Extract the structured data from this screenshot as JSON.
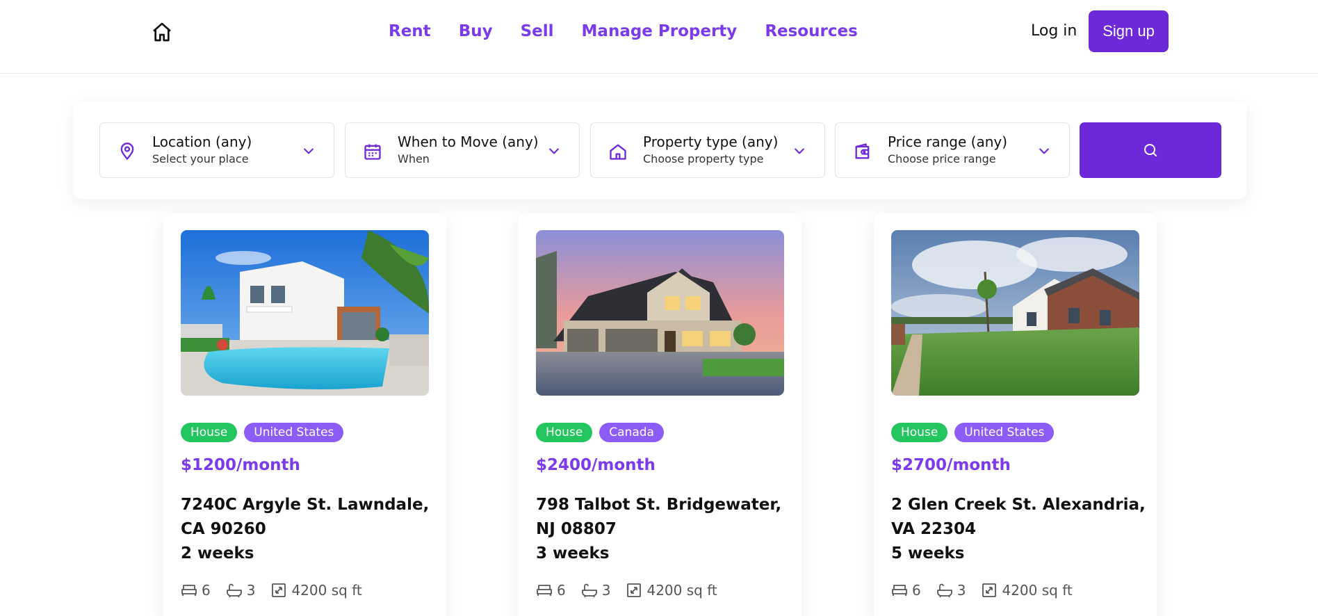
{
  "header": {
    "logo_icon": "home-icon",
    "nav": [
      {
        "label": "Rent"
      },
      {
        "label": "Buy"
      },
      {
        "label": "Sell"
      },
      {
        "label": "Manage Property"
      },
      {
        "label": "Resources"
      }
    ],
    "login_label": "Log in",
    "signup_label": "Sign up"
  },
  "colors": {
    "accent": "#6d28d9",
    "accent_text": "#7c3aed",
    "tag_green": "#22c55e",
    "tag_purple": "#8b5cf6"
  },
  "search": {
    "filters": [
      {
        "icon": "map-pin-icon",
        "title": "Location (any)",
        "subtitle": "Select your place"
      },
      {
        "icon": "calendar-icon",
        "title": "When to Move (any)",
        "subtitle": "When"
      },
      {
        "icon": "house-icon",
        "title": "Property type (any)",
        "subtitle": "Choose property type"
      },
      {
        "icon": "wallet-icon",
        "title": "Price range (any)",
        "subtitle": "Choose price range"
      }
    ],
    "button_icon": "search-icon"
  },
  "listings": [
    {
      "type": "House",
      "country": "United States",
      "price": "$1200/month",
      "address_line1": "7240C Argyle St. Lawndale,",
      "address_line2": "CA 90260",
      "duration": "2 weeks",
      "beds": "6",
      "baths": "3",
      "area": "4200 sq ft"
    },
    {
      "type": "House",
      "country": "Canada",
      "price": "$2400/month",
      "address_line1": "798 Talbot St. Bridgewater,",
      "address_line2": "NJ 08807",
      "duration": "3 weeks",
      "beds": "6",
      "baths": "3",
      "area": "4200 sq ft"
    },
    {
      "type": "House",
      "country": "United States",
      "price": "$2700/month",
      "address_line1": "2 Glen Creek St. Alexandria,",
      "address_line2": "VA 22304",
      "duration": "5 weeks",
      "beds": "6",
      "baths": "3",
      "area": "4200 sq ft"
    }
  ]
}
